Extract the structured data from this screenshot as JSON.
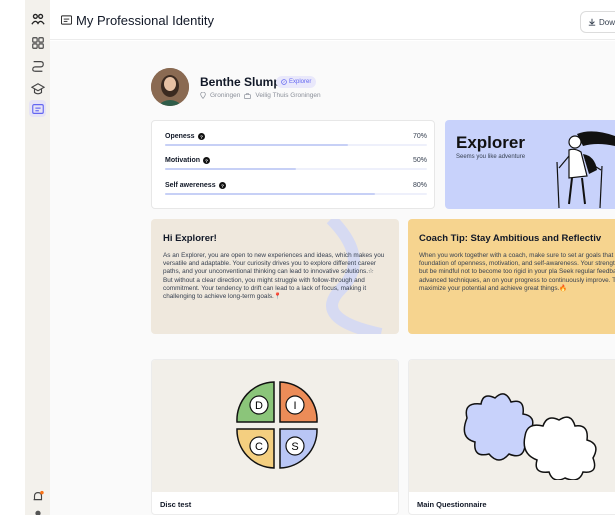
{
  "header": {
    "title": "My Professional Identity",
    "download_label": "Down"
  },
  "sidebar": {
    "items": [
      {
        "icon": "people-icon"
      },
      {
        "icon": "grid-icon"
      },
      {
        "icon": "route-icon"
      },
      {
        "icon": "graduation-cap-icon"
      },
      {
        "icon": "id-card-icon"
      }
    ],
    "bottom": [
      {
        "icon": "notification-bell-icon"
      },
      {
        "icon": "user-icon"
      }
    ]
  },
  "profile": {
    "name": "Benthe Slump",
    "badge": "Explorer",
    "location": "Groningen",
    "organization": "Veilig Thuis Groningen"
  },
  "metrics": [
    {
      "label": "Openess",
      "value": "70%",
      "fraction": 0.7
    },
    {
      "label": "Motivation",
      "value": "50%",
      "fraction": 0.5
    },
    {
      "label": "Self awereness",
      "value": "80%",
      "fraction": 0.8
    }
  ],
  "explorer": {
    "title": "Explorer",
    "subtitle": "Seems you like adventure"
  },
  "hi_card": {
    "title": "Hi Explorer!",
    "body": "As an Explorer, you are open to new experiences and ideas, which makes you versatile and adaptable. Your curiosity drives you to explore different career paths, and your unconventional thinking can lead to innovative solutions.☆\nBut without a clear direction, you might struggle with follow-through and commitment. Your tendency to drift can lead to a lack of focus, making it challenging to achieve long-term goals.📍"
  },
  "coach_card": {
    "title": "Coach Tip: Stay Ambitious and Reflectiv",
    "body": "When you work together with a coach, make sure to set ar goals that leverage your strong foundation of openness, motivation, and self-awareness. Your strength is your proa attitude, but be mindful not to become too rigid in your pla Seek regular feedback, embrace advanced techniques, an on your progress to continuously improve. This approach w you maximize your potential and achieve great things.🔥"
  },
  "tests": [
    {
      "title": "Disc test",
      "letters": [
        "D",
        "I",
        "C",
        "S"
      ]
    },
    {
      "title": "Main Questionnaire"
    }
  ],
  "colors": {
    "explorer_bg": "#c8d2fb",
    "hi_bg": "#efe8dd",
    "coach_bg": "#f6d48f",
    "badge_text": "#6366f1",
    "disc_d": "#8bc57a",
    "disc_i": "#ec8c58",
    "disc_c": "#f4cf80",
    "disc_s": "#b9c6f5"
  }
}
